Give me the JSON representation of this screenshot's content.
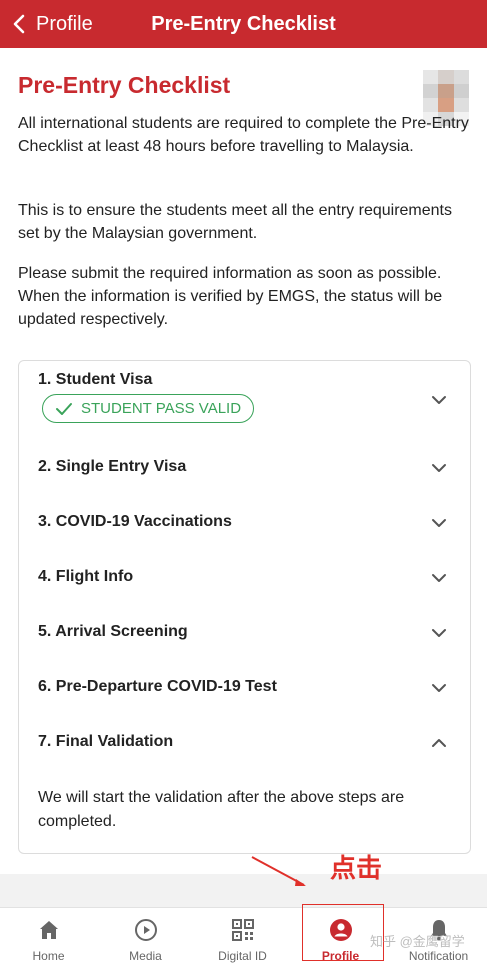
{
  "header": {
    "back_label": "Profile",
    "title": "Pre-Entry Checklist",
    "background": "#c82a2f"
  },
  "main": {
    "heading": "Pre-Entry Checklist",
    "paragraphs": [
      "All international students are required to complete the Pre-Entry Checklist at least 48 hours before travelling to Malaysia.",
      "This is to ensure the students meet all the entry requirements set by the Malaysian government.",
      "Please submit the required information as soon as possible. When the information is verified by EMGS, the status will be updated respectively."
    ]
  },
  "checklist": {
    "items": [
      {
        "label": "1. Student Visa",
        "state": "collapsed",
        "icon": "chevron-down-icon"
      },
      {
        "label": "2. Single Entry Visa",
        "state": "collapsed",
        "icon": "chevron-down-icon"
      },
      {
        "label": "3. COVID-19 Vaccinations",
        "state": "collapsed",
        "icon": "chevron-down-icon"
      },
      {
        "label": "4. Flight Info",
        "state": "collapsed",
        "icon": "chevron-down-icon"
      },
      {
        "label": "5. Arrival Screening",
        "state": "collapsed",
        "icon": "chevron-down-icon"
      },
      {
        "label": "6. Pre-Departure COVID-19 Test",
        "state": "collapsed",
        "icon": "chevron-down-icon"
      },
      {
        "label": "7. Final Validation",
        "state": "expanded",
        "icon": "chevron-up-icon"
      }
    ],
    "student_pass_badge": "STUDENT PASS VALID",
    "final_validation_text": "We will start the validation after the above steps are completed.",
    "badge_color": "#3aa35a"
  },
  "annotation": {
    "text": "点击",
    "color": "#e0302a"
  },
  "tabbar": {
    "tabs": [
      {
        "label": "Home",
        "icon": "home-icon",
        "active": false
      },
      {
        "label": "Media",
        "icon": "play-icon",
        "active": false
      },
      {
        "label": "Digital ID",
        "icon": "qr-code-icon",
        "active": false
      },
      {
        "label": "Profile",
        "icon": "user-icon",
        "active": true
      },
      {
        "label": "Notification",
        "icon": "bell-icon",
        "active": false
      }
    ],
    "active_color": "#c82a2f"
  },
  "watermark": "知乎 @金鹰留学"
}
